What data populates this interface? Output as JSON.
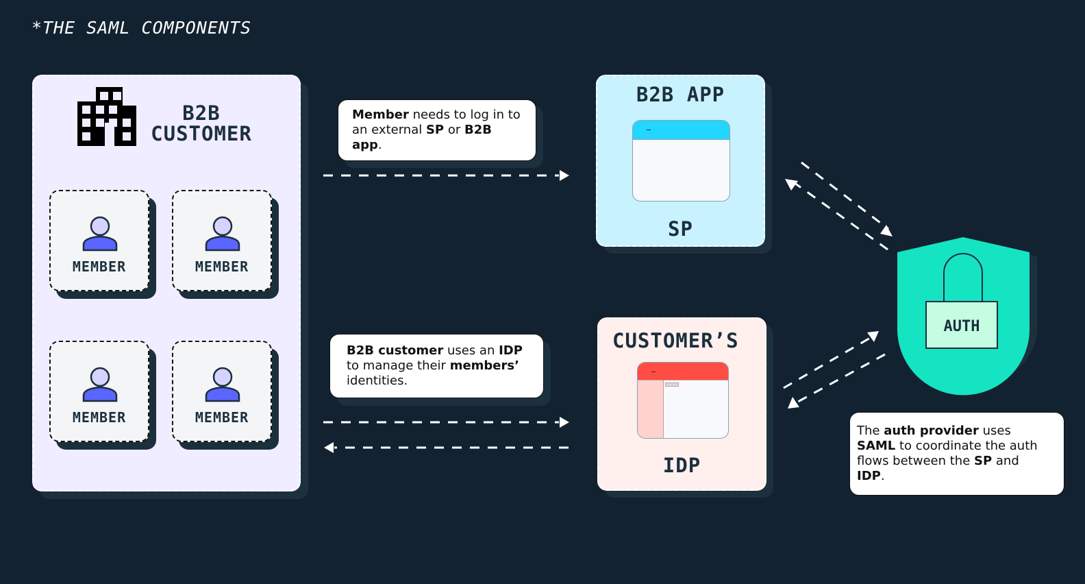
{
  "title": "*THE SAML COMPONENTS",
  "customer": {
    "label_line1": "B2B",
    "label_line2": "CUSTOMER",
    "icon": "building-icon",
    "members": [
      {
        "label": "MEMBER",
        "icon": "user-icon"
      },
      {
        "label": "MEMBER",
        "icon": "user-icon"
      },
      {
        "label": "MEMBER",
        "icon": "user-icon"
      },
      {
        "label": "MEMBER",
        "icon": "user-icon"
      }
    ]
  },
  "callouts": {
    "member_login": {
      "b1": "Member",
      "t1": " needs to log in to an external ",
      "b2": "SP",
      "t2": " or ",
      "b3": "B2B app",
      "t3": "."
    },
    "customer_idp": {
      "b1": "B2B customer",
      "t1": " uses an ",
      "b2": "IDP",
      "t2": " to manage their ",
      "b3": "members’",
      "t3": " identities."
    },
    "auth_provider": {
      "t0": "The ",
      "b1": "auth provider",
      "t1": " uses ",
      "b2": "SAML",
      "t2": " to coordinate the auth flows between the ",
      "b3": "SP",
      "t3": " and ",
      "b4": "IDP",
      "t4": "."
    }
  },
  "sp": {
    "heading": "B2B APP",
    "footer": "SP",
    "window_icon": "app-window-icon",
    "accent": "#22d6ff",
    "background": "#c9f2ff"
  },
  "idp": {
    "heading": "CUSTOMER’S",
    "footer": "IDP",
    "window_icon": "idp-window-icon",
    "accent": "#ff4d45",
    "background": "#ffefed"
  },
  "auth": {
    "label": "AUTH",
    "icon": "shield-lock-icon",
    "accent": "#15e4c2"
  },
  "colors": {
    "background": "#132230",
    "customer_panel": "#efedff",
    "member_icon": "#5b65ff",
    "member_head": "#d6d3ff"
  }
}
